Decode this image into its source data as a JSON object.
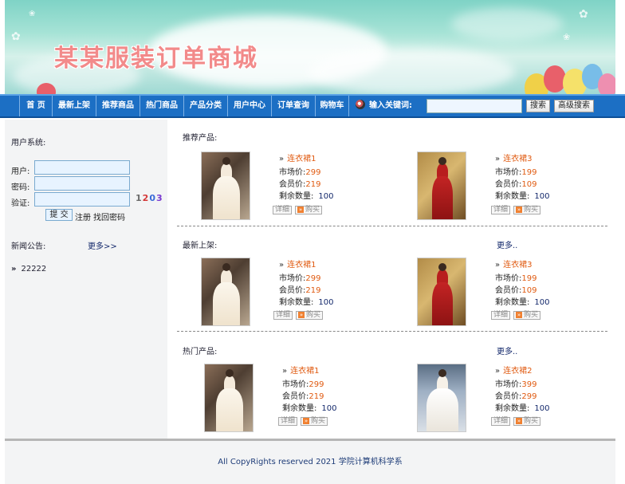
{
  "banner": {
    "title": "某某服装订单商城"
  },
  "nav": {
    "items": [
      "首 页",
      "最新上架",
      "推荐商品",
      "热门商品",
      "产品分类",
      "用户中心",
      "订单查询",
      "购物车"
    ],
    "keyword_label": "输入关键词:",
    "search_placeholder": "",
    "search_button": "搜索",
    "advanced_button": "高级搜索"
  },
  "sidebar": {
    "user_heading": "用户系统:",
    "user_label": "用户:",
    "password_label": "密码:",
    "verify_label": "验证:",
    "captcha": "1203",
    "submit_button": "提 交",
    "register_link": "注册",
    "recover_link": "找回密码",
    "news_heading": "新闻公告:",
    "news_more": "更多>>",
    "news_items": [
      "22222"
    ]
  },
  "main": {
    "sections": [
      {
        "title": "推荐产品:",
        "more": "",
        "products": [
          {
            "name": "连衣裙1",
            "market_label": "市场价:",
            "market_price": "299",
            "member_label": "会员价:",
            "member_price": "219",
            "stock_label": "剩余数量:",
            "stock": "100",
            "detail": "详细",
            "buy": "购买",
            "style": "white"
          },
          {
            "name": "连衣裙3",
            "market_label": "市场价:",
            "market_price": "199",
            "member_label": "会员价:",
            "member_price": "109",
            "stock_label": "剩余数量:",
            "stock": "100",
            "detail": "详细",
            "buy": "购买",
            "style": "red"
          }
        ]
      },
      {
        "title": "最新上架:",
        "more": "更多..",
        "products": [
          {
            "name": "连衣裙1",
            "market_label": "市场价:",
            "market_price": "299",
            "member_label": "会员价:",
            "member_price": "219",
            "stock_label": "剩余数量:",
            "stock": "100",
            "detail": "详细",
            "buy": "购买",
            "style": "white"
          },
          {
            "name": "连衣裙3",
            "market_label": "市场价:",
            "market_price": "199",
            "member_label": "会员价:",
            "member_price": "109",
            "stock_label": "剩余数量:",
            "stock": "100",
            "detail": "详细",
            "buy": "购买",
            "style": "red"
          }
        ]
      },
      {
        "title": "热门产品:",
        "more": "更多..",
        "products": [
          {
            "name": "连衣裙1",
            "market_label": "市场价:",
            "market_price": "299",
            "member_label": "会员价:",
            "member_price": "219",
            "stock_label": "剩余数量:",
            "stock": "100",
            "detail": "详细",
            "buy": "购买",
            "style": "white"
          },
          {
            "name": "连衣裙2",
            "market_label": "市场价:",
            "market_price": "399",
            "member_label": "会员价:",
            "member_price": "299",
            "stock_label": "剩余数量:",
            "stock": "100",
            "detail": "详细",
            "buy": "购买",
            "style": "gown"
          }
        ]
      }
    ]
  },
  "footer": {
    "text": "All CopyRights reserved 2021 学院计算机科学系"
  },
  "colors": {
    "nav": "#1c6fc4",
    "price": "#e05a10",
    "link": "#13286b",
    "banner_title": "#f28a8a"
  }
}
